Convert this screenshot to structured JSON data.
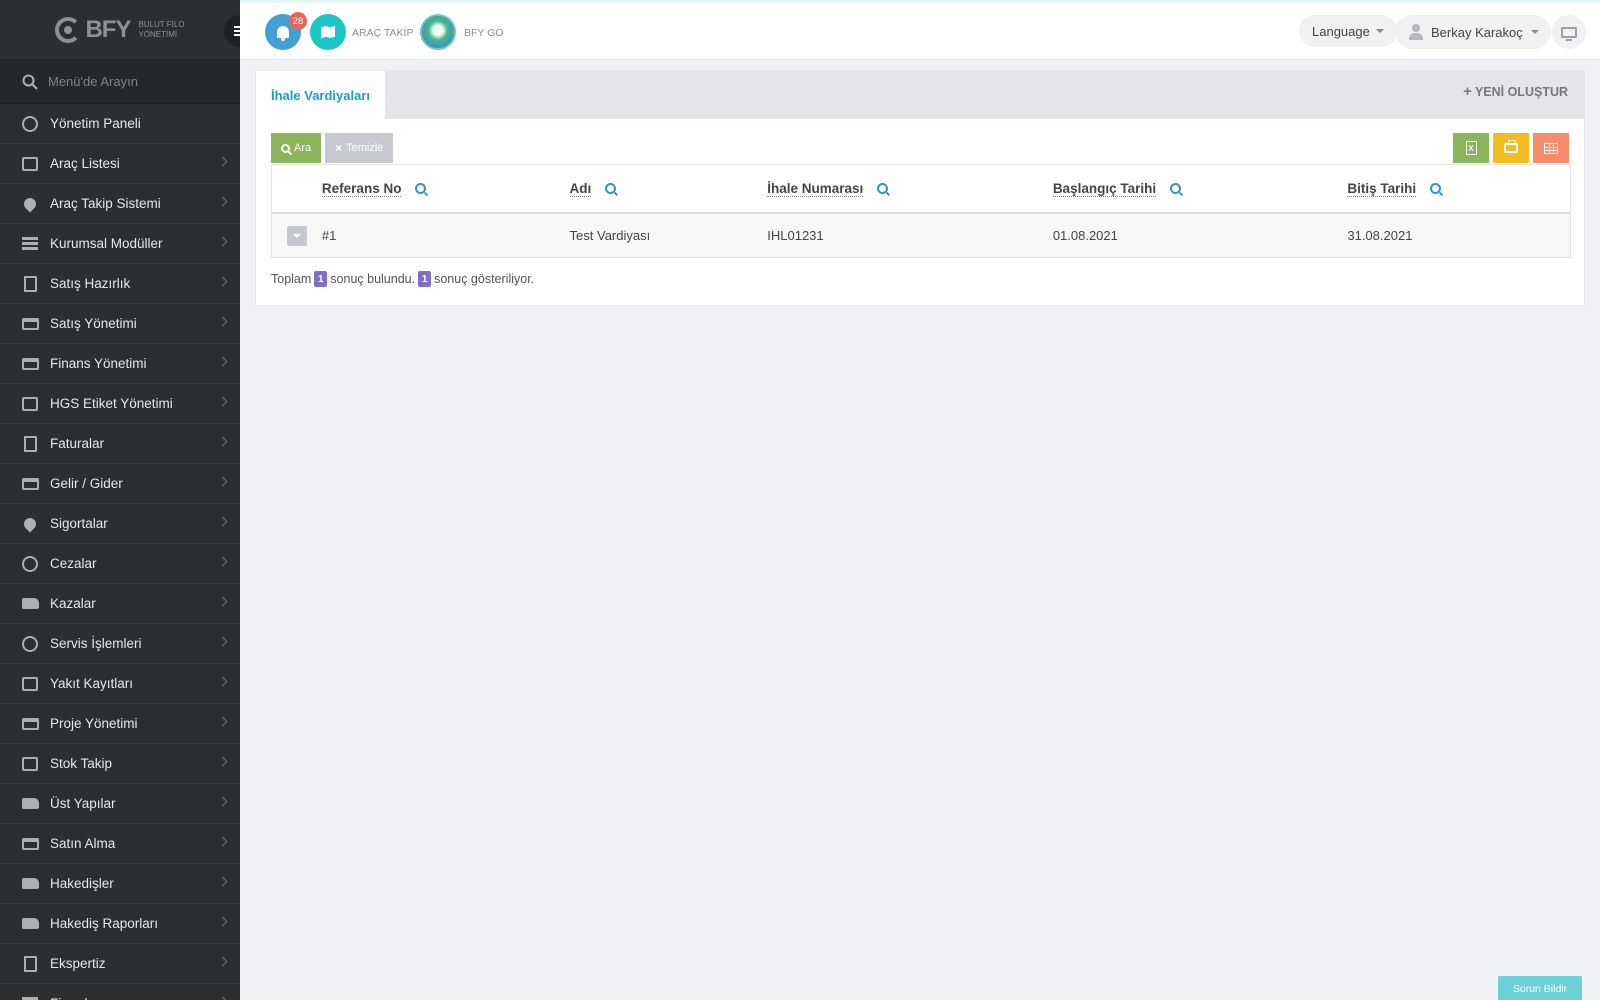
{
  "brand": {
    "logo_text": "BFY",
    "logo_sub_line1": "BULUT FİLO",
    "logo_sub_line2": "YÖNETİMİ"
  },
  "sidebar": {
    "search_placeholder": "Menü'de Arayın",
    "items": [
      {
        "label": "Yönetim Paneli",
        "icon": "dashboard-icon",
        "has_submenu": false
      },
      {
        "label": "Araç Listesi",
        "icon": "bus-icon",
        "has_submenu": true
      },
      {
        "label": "Araç Takip Sistemi",
        "icon": "map-marker-icon",
        "has_submenu": true
      },
      {
        "label": "Kurumsal Modüller",
        "icon": "server-icon",
        "has_submenu": true
      },
      {
        "label": "Satış Hazırlık",
        "icon": "book-icon",
        "has_submenu": true
      },
      {
        "label": "Satış Yönetimi",
        "icon": "credit-card-icon",
        "has_submenu": true
      },
      {
        "label": "Finans Yönetimi",
        "icon": "money-icon",
        "has_submenu": true
      },
      {
        "label": "HGS Etiket Yönetimi",
        "icon": "tags-icon",
        "has_submenu": true
      },
      {
        "label": "Faturalar",
        "icon": "file-icon",
        "has_submenu": true
      },
      {
        "label": "Gelir / Gider",
        "icon": "money-icon",
        "has_submenu": true
      },
      {
        "label": "Sigortalar",
        "icon": "umbrella-icon",
        "has_submenu": true
      },
      {
        "label": "Cezalar",
        "icon": "times-circle-icon",
        "has_submenu": true
      },
      {
        "label": "Kazalar",
        "icon": "car-crash-icon",
        "has_submenu": true
      },
      {
        "label": "Servis İşlemleri",
        "icon": "check-circle-icon",
        "has_submenu": true
      },
      {
        "label": "Yakıt Kayıtları",
        "icon": "fuel-pump-icon",
        "has_submenu": true
      },
      {
        "label": "Proje Yönetimi",
        "icon": "briefcase-icon",
        "has_submenu": true
      },
      {
        "label": "Stok Takip",
        "icon": "inbox-icon",
        "has_submenu": true
      },
      {
        "label": "Üst Yapılar",
        "icon": "truck-icon",
        "has_submenu": true
      },
      {
        "label": "Satın Alma",
        "icon": "credit-card-icon",
        "has_submenu": true
      },
      {
        "label": "Hakedişler",
        "icon": "truck-icon",
        "has_submenu": true
      },
      {
        "label": "Hakediş Raporları",
        "icon": "truck-icon",
        "has_submenu": true
      },
      {
        "label": "Ekspertiz",
        "icon": "list-alt-icon",
        "has_submenu": true
      },
      {
        "label": "Firmalar",
        "icon": "building-icon",
        "has_submenu": true
      }
    ]
  },
  "header": {
    "notification_count": "28",
    "arac_takip_label": "ARAÇ TAKİP",
    "bfy_go_label": "BFY GO",
    "language_label": "Language",
    "user_name": "Berkay Karakoç"
  },
  "panel": {
    "tab_label": "İhale Vardiyaları",
    "new_button_label": "YENİ OLUŞTUR",
    "search_button_label": "Ara",
    "clear_button_label": "Temizle",
    "columns": [
      "Referans No",
      "Adı",
      "İhale Numarası",
      "Başlangıç Tarihi",
      "Bitiş Tarihi"
    ],
    "rows": [
      {
        "ref": "#1",
        "name": "Test Vardiyası",
        "tender_no": "IHL01231",
        "start": "01.08.2021",
        "end": "31.08.2021"
      }
    ],
    "summary": {
      "prefix": "Toplam",
      "found_count": "1",
      "found_text": "sonuç bulundu.",
      "shown_count": "1",
      "shown_text": "sonuç gösteriliyor."
    }
  },
  "report_button_label": "Sorun Bildir",
  "colors": {
    "sidebar_bg": "#2b2f31",
    "accent_teal": "#17a2b8",
    "btn_green": "#8bb45b",
    "btn_yellow": "#f2bd1f",
    "btn_orange": "#f58c6a",
    "badge_purple": "#7f6fc7",
    "notif_red": "#e76654"
  }
}
